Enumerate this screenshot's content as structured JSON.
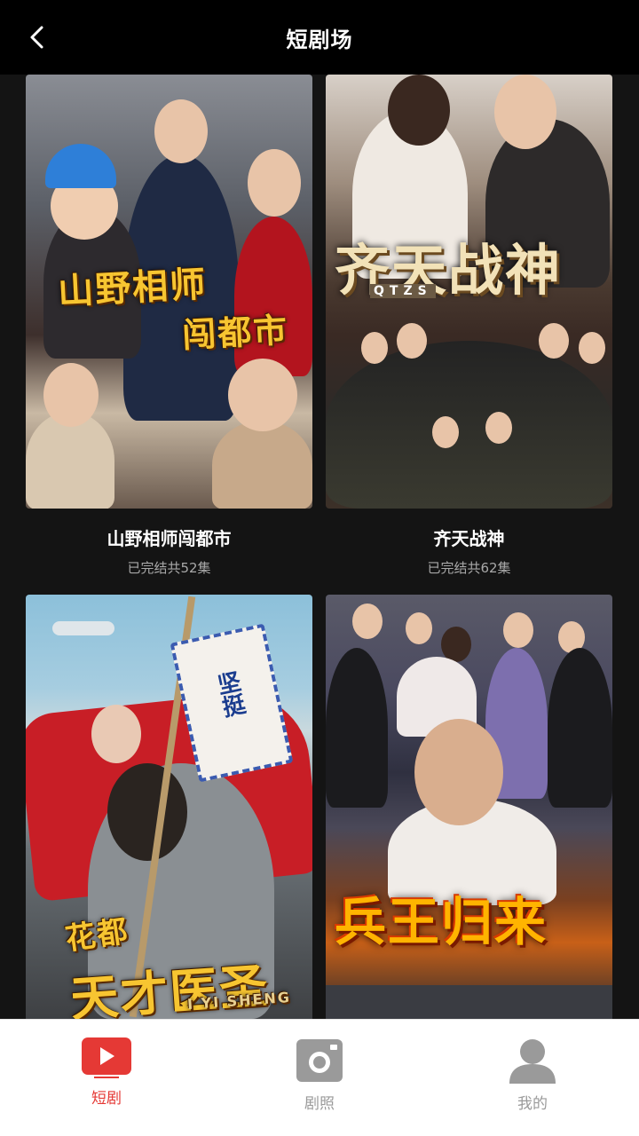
{
  "header": {
    "title": "短剧场"
  },
  "dramas": [
    {
      "name": "山野相师闯都市",
      "status": "已完结共52集",
      "poster_title_line1": "山野相师",
      "poster_title_line2": "闯都市"
    },
    {
      "name": "齐天战神",
      "status": "已完结共62集",
      "poster_title_line1": "齐天战神",
      "poster_subtitle": "QTZS"
    },
    {
      "name": "",
      "status": "",
      "poster_title_line1": "花都",
      "poster_title_line2": "天才医圣",
      "poster_subtitle": "I YI SHENG",
      "poster_sign": "坚挺"
    },
    {
      "name": "",
      "status": "",
      "poster_title_line1": "兵王归来"
    }
  ],
  "nav": {
    "items": [
      {
        "label": "短剧",
        "icon": "play-icon",
        "active": true
      },
      {
        "label": "剧照",
        "icon": "camera-icon",
        "active": false
      },
      {
        "label": "我的",
        "icon": "user-icon",
        "active": false
      }
    ],
    "active_color": "#e53935",
    "inactive_color": "#9a9a9a"
  }
}
